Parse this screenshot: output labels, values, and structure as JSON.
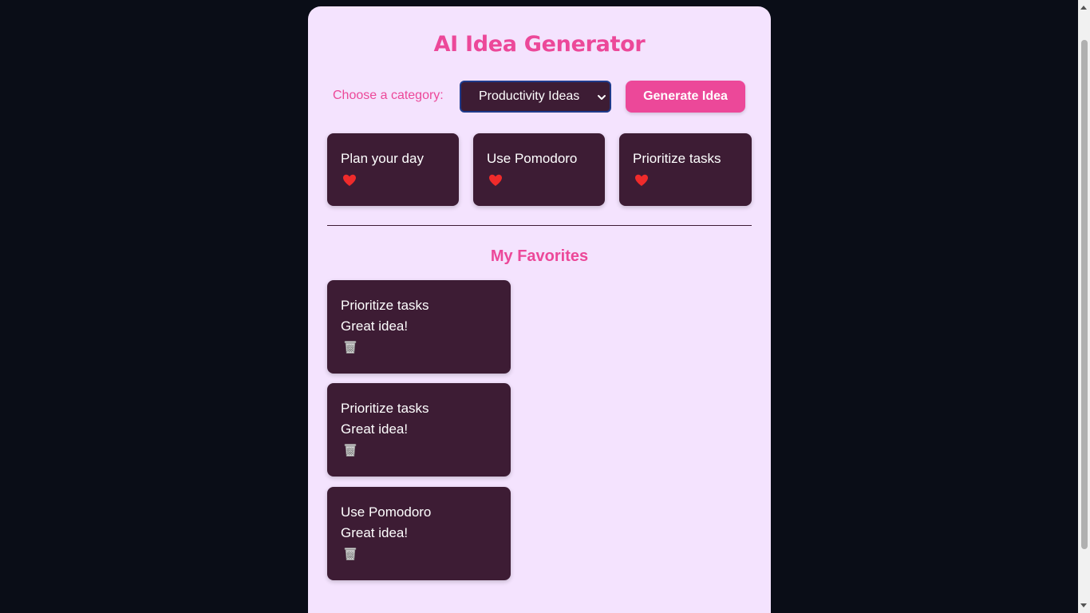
{
  "app": {
    "title": "AI Idea Generator"
  },
  "controls": {
    "category_label": "Choose a category:",
    "selected_category": "Productivity Ideas",
    "generate_label": "Generate Idea"
  },
  "ideas": [
    {
      "text": "Plan your day",
      "icon": "heart-icon"
    },
    {
      "text": "Use Pomodoro",
      "icon": "heart-icon"
    },
    {
      "text": "Prioritize tasks",
      "icon": "heart-icon"
    }
  ],
  "favorites": {
    "title": "My Favorites",
    "items": [
      {
        "text": "Prioritize tasks",
        "note": "Great idea!",
        "icon": "trash-icon"
      },
      {
        "text": "Prioritize tasks",
        "note": "Great idea!",
        "icon": "trash-icon"
      },
      {
        "text": "Use Pomodoro",
        "note": "Great idea!",
        "icon": "trash-icon"
      }
    ]
  },
  "colors": {
    "page_bg": "#0a0d17",
    "panel_bg": "#f4e3fe",
    "accent": "#ec4899",
    "card_bg": "#3d1c34",
    "heart": "#ef2b2b"
  }
}
